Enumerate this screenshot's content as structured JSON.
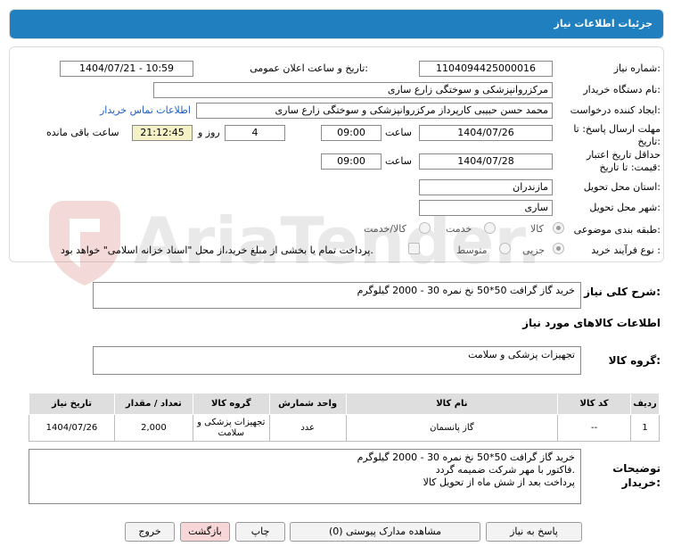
{
  "header": {
    "title": "جزئیات اطلاعات نیاز"
  },
  "form": {
    "need_number": {
      "label": "شماره نیاز:",
      "value": "1104094425000016"
    },
    "announce": {
      "label": "تاریخ و ساعت اعلان عمومی:",
      "value": "1404/07/21 - 10:59"
    },
    "buyer": {
      "label": "نام دستگاه خریدار:",
      "value": "مرکزروانپزشکی و سوختگی زارع ساری"
    },
    "creator": {
      "label": "ایجاد کننده درخواست:",
      "value": "محمد حسن حبیبی کارپرداز مرکزروانپزشکی و سوختگی زارع ساری",
      "contact_link": "اطلاعات تماس خریدار"
    },
    "deadline": {
      "label_line1": "مهلت ارسال پاسخ: تا",
      "label_line2": "تاریخ:",
      "date": "1404/07/26",
      "time_label": "ساعت",
      "time": "09:00",
      "days": "4",
      "days_label": "روز و",
      "remaining": "21:12:45",
      "remaining_label": "ساعت باقی مانده"
    },
    "validity": {
      "label_line1": "حداقل تاریخ اعتبار",
      "label_line2": "قیمت: تا تاریخ:",
      "date": "1404/07/28",
      "time_label": "ساعت",
      "time": "09:00"
    },
    "province": {
      "label": "استان محل تحویل:",
      "value": "مازندران"
    },
    "city": {
      "label": "شهر محل تحویل:",
      "value": "ساری"
    },
    "category": {
      "label": "طبقه بندی موضوعی:",
      "options": [
        "کالا",
        "خدمت",
        "کالا/خدمت"
      ],
      "selected": "کالا"
    },
    "process": {
      "label": "نوع فرآیند خرید :",
      "options": [
        "جزیی",
        "متوسط"
      ],
      "selected": "جزیی",
      "payment_note": "پرداخت تمام یا بخشی از مبلغ خرید،از محل \"اسناد خزانه اسلامی\" خواهد بود."
    }
  },
  "summary": {
    "label": "شرح کلی نیاز:",
    "value": "خرید گاز گرافت 50*50  نخ نمره 30 - 2000 گیلوگرم"
  },
  "goods_info": {
    "title": "اطلاعات کالاهای مورد نیاز"
  },
  "goods_group": {
    "label": "گروه کالا:",
    "value": "تجهیزات پزشکی و سلامت"
  },
  "table": {
    "headers": [
      "ردیف",
      "کد کالا",
      "نام کالا",
      "واحد شمارش",
      "گروه کالا",
      "تعداد / مقدار",
      "تاریخ نیاز"
    ],
    "rows": [
      {
        "row": "1",
        "code": "--",
        "name": "گاز پانسمان",
        "unit": "عدد",
        "group": "تجهیزات پزشکی و سلامت",
        "qty": "2,000",
        "date": "1404/07/26"
      }
    ]
  },
  "buyer_notes": {
    "label_line1": "توضیحات",
    "label_line2": "خریدار:",
    "lines": [
      "خرید گاز گرافت 50*50  نخ نمره 30 - 2000 گیلوگرم",
      "فاکتور با مهر شرکت ضمیمه گردد.",
      "پرداخت بعد از شش ماه از تحویل کالا"
    ]
  },
  "buttons": {
    "reply": "پاسخ به نیاز",
    "docs": "مشاهده مدارک پیوستی (0)",
    "print": "چاپ",
    "back": "بازگشت",
    "exit": "خروج"
  },
  "watermark": {
    "text": "AriaTender.neT"
  },
  "colors": {
    "header_bg": "#1f7fbf",
    "link": "#1f5fbf",
    "remaining_bg": "#f4f1c6",
    "back_btn_bg": "#f6d6d6",
    "table_header_bg": "#dedede"
  },
  "icons": {
    "watermark": "shield-logo-icon"
  }
}
